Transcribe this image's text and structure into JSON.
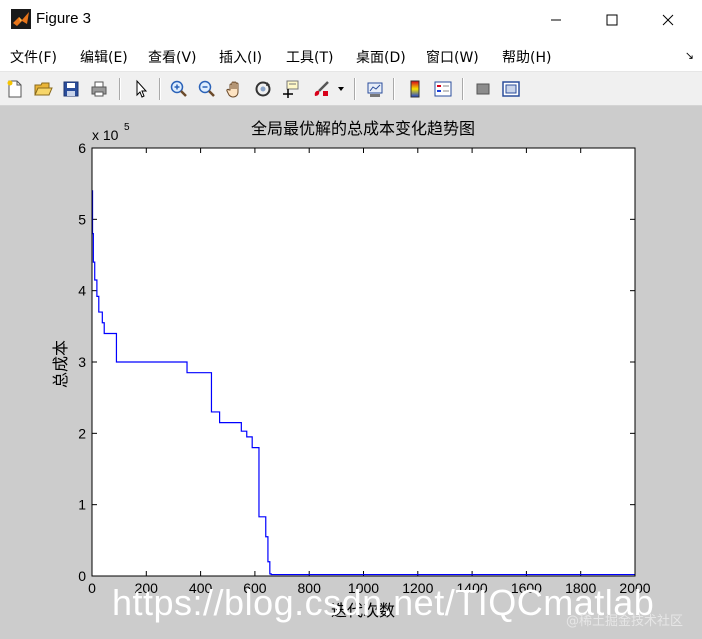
{
  "window": {
    "title": "Figure 3",
    "controls": {
      "minimize": "—",
      "maximize": "☐",
      "close": "✕"
    }
  },
  "menubar": {
    "items": [
      {
        "label": "文件(F)"
      },
      {
        "label": "编辑(E)"
      },
      {
        "label": "查看(V)"
      },
      {
        "label": "插入(I)"
      },
      {
        "label": "工具(T)"
      },
      {
        "label": "桌面(D)"
      },
      {
        "label": "窗口(W)"
      },
      {
        "label": "帮助(H)"
      }
    ],
    "overflow_icon": "arrow-down-right"
  },
  "toolbar": {
    "tools": [
      {
        "name": "new-figure",
        "icon": "new-document-icon"
      },
      {
        "name": "open-file",
        "icon": "open-folder-icon"
      },
      {
        "name": "save-figure",
        "icon": "save-disk-icon"
      },
      {
        "name": "print-figure",
        "icon": "printer-icon"
      },
      {
        "name": "edit-plot",
        "icon": "pointer-arrow-icon"
      },
      {
        "name": "zoom-in",
        "icon": "zoom-in-icon"
      },
      {
        "name": "zoom-out",
        "icon": "zoom-out-icon"
      },
      {
        "name": "pan",
        "icon": "hand-icon"
      },
      {
        "name": "rotate-3d",
        "icon": "rotate-icon"
      },
      {
        "name": "data-cursor",
        "icon": "data-cursor-icon"
      },
      {
        "name": "brush",
        "icon": "brush-icon"
      },
      {
        "name": "link-plot",
        "icon": "link-plot-icon"
      },
      {
        "name": "insert-colorbar",
        "icon": "colorbar-icon"
      },
      {
        "name": "insert-legend",
        "icon": "legend-icon"
      },
      {
        "name": "hide-plot-tools",
        "icon": "hide-tools-icon"
      },
      {
        "name": "show-plot-tools",
        "icon": "show-tools-icon"
      }
    ]
  },
  "colors": {
    "figure_background": "#cccccc",
    "axes_background": "#ffffff",
    "line": "#0000ff",
    "watermark": "#ffffff"
  },
  "chart_data": {
    "type": "line",
    "title": "全局最优解的总成本变化趋势图",
    "xlabel": "迭代次数",
    "ylabel": "总成本",
    "y_exponent_label": "x 10",
    "y_exponent_power": "5",
    "xlim": [
      0,
      2000
    ],
    "ylim": [
      0,
      6
    ],
    "y_multiplier": 100000,
    "grid": false,
    "x_ticks": [
      0,
      200,
      400,
      600,
      800,
      1000,
      1200,
      1400,
      1600,
      1800,
      2000
    ],
    "y_ticks": [
      0,
      1,
      2,
      3,
      4,
      5,
      6
    ],
    "series": [
      {
        "x": [
          0,
          2,
          2,
          5,
          5,
          10,
          10,
          18,
          18,
          25,
          25,
          38,
          38,
          45,
          45,
          90,
          90,
          350,
          350,
          440,
          440,
          470,
          470,
          550,
          550,
          570,
          570,
          590,
          590,
          615,
          615,
          640,
          640,
          648,
          648,
          655,
          655,
          660,
          660,
          2000
        ],
        "y": [
          5.4,
          5.4,
          4.8,
          4.8,
          4.4,
          4.4,
          4.15,
          4.15,
          3.92,
          3.92,
          3.7,
          3.7,
          3.55,
          3.55,
          3.4,
          3.4,
          3.0,
          3.0,
          2.85,
          2.85,
          2.3,
          2.3,
          2.15,
          2.15,
          2.03,
          2.03,
          1.95,
          1.95,
          1.8,
          1.8,
          0.83,
          0.83,
          0.55,
          0.55,
          0.2,
          0.2,
          0.03,
          0.03,
          0.02,
          0.02
        ]
      }
    ]
  },
  "watermark": {
    "text": "https://blog.csdn.net/TIQCmatlab",
    "secondary": "@稀土掘金技术社区"
  }
}
